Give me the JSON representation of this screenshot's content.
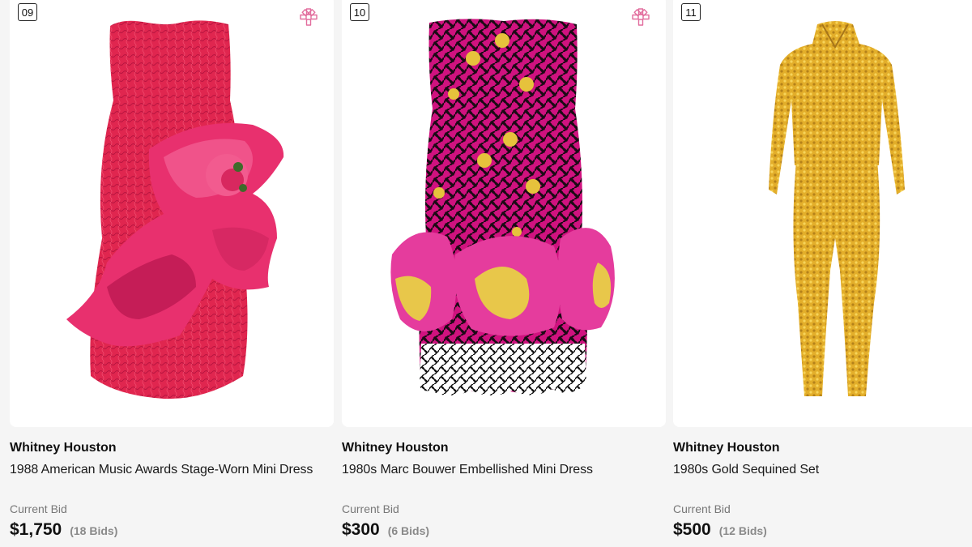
{
  "accent_color": "#e26d9d",
  "lots": [
    {
      "lot_number": "09",
      "artist": "Whitney Houston",
      "title": "1988 American Music Awards Stage-Worn Mini Dress",
      "bid_label": "Current Bid",
      "bid_amount": "$1,750",
      "bid_count": "(18 Bids)",
      "favorite_icon": "asterisk-flower-icon"
    },
    {
      "lot_number": "10",
      "artist": "Whitney Houston",
      "title": "1980s Marc Bouwer Embellished Mini Dress",
      "bid_label": "Current Bid",
      "bid_amount": "$300",
      "bid_count": "(6 Bids)",
      "favorite_icon": "asterisk-flower-icon"
    },
    {
      "lot_number": "11",
      "artist": "Whitney Houston",
      "title": "1980s Gold Sequined Set",
      "bid_label": "Current Bid",
      "bid_amount": "$500",
      "bid_count": "(12 Bids)",
      "favorite_icon": "asterisk-flower-icon"
    }
  ]
}
